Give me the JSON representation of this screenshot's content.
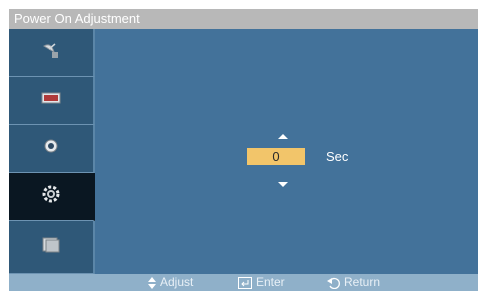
{
  "window": {
    "title": "Power On Adjustment"
  },
  "sidebar": {
    "items": [
      {
        "icon": "satellite-dish-icon",
        "active": false
      },
      {
        "icon": "picture-icon",
        "active": false
      },
      {
        "icon": "sound-icon",
        "active": false
      },
      {
        "icon": "setup-gear-icon",
        "active": true
      },
      {
        "icon": "multi-display-icon",
        "active": false
      }
    ]
  },
  "adjust": {
    "value": "0",
    "unit": "Sec"
  },
  "footer": {
    "adjust_label": "Adjust",
    "enter_label": "Enter",
    "return_label": "Return"
  },
  "colors": {
    "title_bar": "#b8b8b8",
    "content": "#43729a",
    "sidebar": "#2f5878",
    "value_highlight": "#f2c56a",
    "footer": "#8fb0c9"
  }
}
